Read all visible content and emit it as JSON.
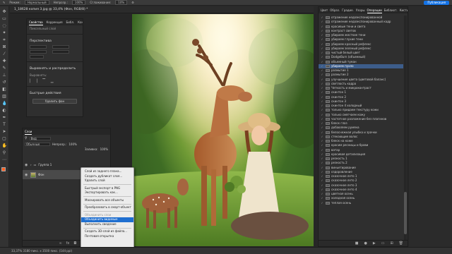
{
  "options_bar": {
    "mode_label": "Режим:",
    "mode_value": "Нормальный",
    "opacity_label": "Непрозр.:",
    "opacity_value": "100%",
    "smoothing_label": "Сглаживание:",
    "smoothing_value": "10%",
    "publish_label": "Публикация"
  },
  "document": {
    "tab_title": "1_18628 копия 3.jpg @ 33,4% (Фон, RGB/8) *"
  },
  "properties": {
    "tabs": [
      "Свойства",
      "Коррекция",
      "Библ.",
      "Контур",
      "Кисти"
    ],
    "layer_type": "Пиксельный слой",
    "transform_title": "Перспектива",
    "align_title": "Выровнять и распределить",
    "align_label": "Выровнять:",
    "quick_actions_title": "Быстрые действия",
    "remove_bg_button": "Удалить фон"
  },
  "layers": {
    "title": "Слои",
    "filter_label": "Вид",
    "blend_mode": "Обычные",
    "opacity_label": "Непрозр.:",
    "opacity_value": "100%",
    "fill_label": "Заливка:",
    "fill_value": "100%",
    "group_name": "Группа 1",
    "bg_layer_name": "Фон"
  },
  "context_menu": {
    "items": [
      {
        "label": "Слой из заднего плана...",
        "state": "normal"
      },
      {
        "label": "Создать дубликат слоя...",
        "state": "normal"
      },
      {
        "label": "Удалить слой",
        "state": "normal"
      },
      {
        "sep": true
      },
      {
        "label": "Быстрый экспорт в PNG",
        "state": "normal"
      },
      {
        "label": "Экспортировать как...",
        "state": "normal"
      },
      {
        "sep": true
      },
      {
        "label": "Маскировать все объекты",
        "state": "normal"
      },
      {
        "sep": true
      },
      {
        "label": "Преобразовать в смарт-объект",
        "state": "normal"
      },
      {
        "sep": true
      },
      {
        "label": "Объединить слои",
        "state": "disabled"
      },
      {
        "label": "Объединить видимые",
        "state": "selected"
      },
      {
        "label": "Выполнить сведение",
        "state": "normal"
      },
      {
        "sep": true
      },
      {
        "label": "Создать 3D-слой из файла...",
        "state": "normal"
      },
      {
        "label": "Почтовая открытка",
        "state": "normal"
      }
    ]
  },
  "history": {
    "tabs": [
      "Цвет",
      "Образ.",
      "Градие.",
      "Узоры",
      "Операции",
      "Библиот.",
      "Кисти",
      "Свойств."
    ],
    "items": [
      "отражение недоэкспонированной",
      "отражение недоэкспонированный кадр",
      "красивые тени и света",
      "контраст светов",
      "убираем жесткие тени",
      "убираем глухие тени",
      "убираем красный рефлекс",
      "убираем зеленый рефлекс",
      "чистый белый цвет",
      "DodgeBurn (объемный)",
      "объемный туман",
      "убираем пухло",
      "размытие 1",
      "размытие 2",
      "улучшение цвета (цветовой баланс)",
      "светлость кадра",
      "Четкость и микроконтраст",
      "скинтон 1",
      "скинтон 2",
      "скинтон 3",
      "скинтон 4 холодный",
      "только придаем текстуру кожи",
      "только смягчаем кожу",
      "частотное разложение без плагинов",
      "блеск глаз",
      "добавляем румяна",
      "белоснежная улыбка и зрачки",
      "стекающие волос",
      "блеск на коже",
      "красим ресницы и брови",
      "ватар",
      "красивая детализация",
      "резкость 1",
      "резкость 2",
      "виньетирование",
      "оздоровление",
      "сказочное лето 1",
      "сказочное лето 2",
      "сказочное лето 3",
      "сказочное лето 4",
      "цветная осень",
      "холодная осень",
      "теплая осень"
    ],
    "selected_index": 11
  },
  "status": {
    "text": "33,37%   3180 пикс. x 3500 пикс. (144 ppi)"
  }
}
